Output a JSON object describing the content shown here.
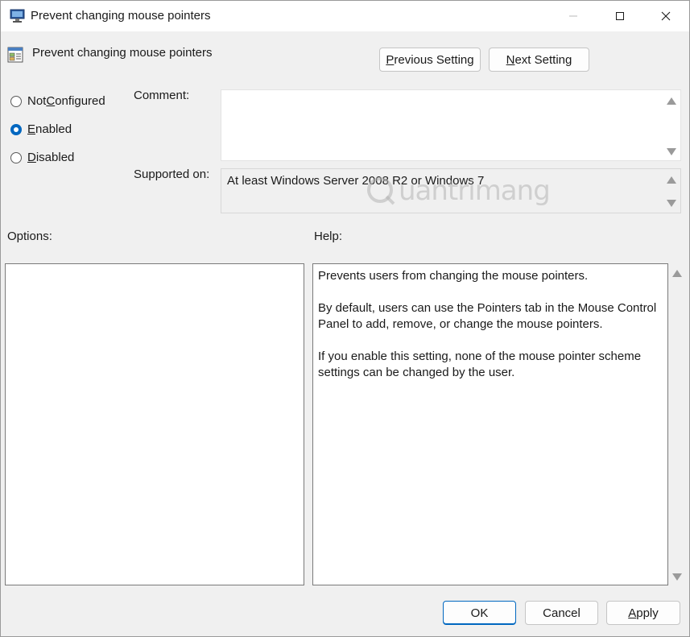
{
  "window": {
    "title": "Prevent changing mouse pointers",
    "controls": {
      "minimize": "minimize-icon",
      "maximize": "maximize-icon",
      "close": "close-icon"
    }
  },
  "header": {
    "title": "Prevent changing mouse pointers",
    "icon": "policy-setting-icon"
  },
  "nav": {
    "previous": {
      "pre": "",
      "key": "P",
      "post": "revious Setting"
    },
    "next": {
      "pre": "",
      "key": "N",
      "post": "ext Setting"
    }
  },
  "state_options": [
    {
      "pre": "Not ",
      "key": "C",
      "post": "onfigured",
      "checked": false
    },
    {
      "pre": "",
      "key": "E",
      "post": "nabled",
      "checked": true
    },
    {
      "pre": "",
      "key": "D",
      "post": "isabled",
      "checked": false
    }
  ],
  "comment": {
    "label": "Comment:",
    "value": ""
  },
  "supported": {
    "label": "Supported on:",
    "value": "At least Windows Server 2008 R2 or Windows 7"
  },
  "options": {
    "label": "Options:"
  },
  "help": {
    "label": "Help:",
    "paragraphs": [
      "Prevents users from changing the mouse pointers.",
      "By default, users can use the Pointers tab in the Mouse Control Panel to add, remove, or change the mouse pointers.",
      "If you enable this setting, none of the mouse pointer scheme settings can be changed by the user."
    ]
  },
  "footer": {
    "ok": "OK",
    "cancel": "Cancel",
    "apply": {
      "pre": "",
      "key": "A",
      "post": "pply"
    }
  },
  "watermark": {
    "text": "uantrimang"
  },
  "colors": {
    "accent": "#0067c0",
    "window_bg": "#f0f0f0",
    "titlebar_bg": "#ffffff"
  }
}
